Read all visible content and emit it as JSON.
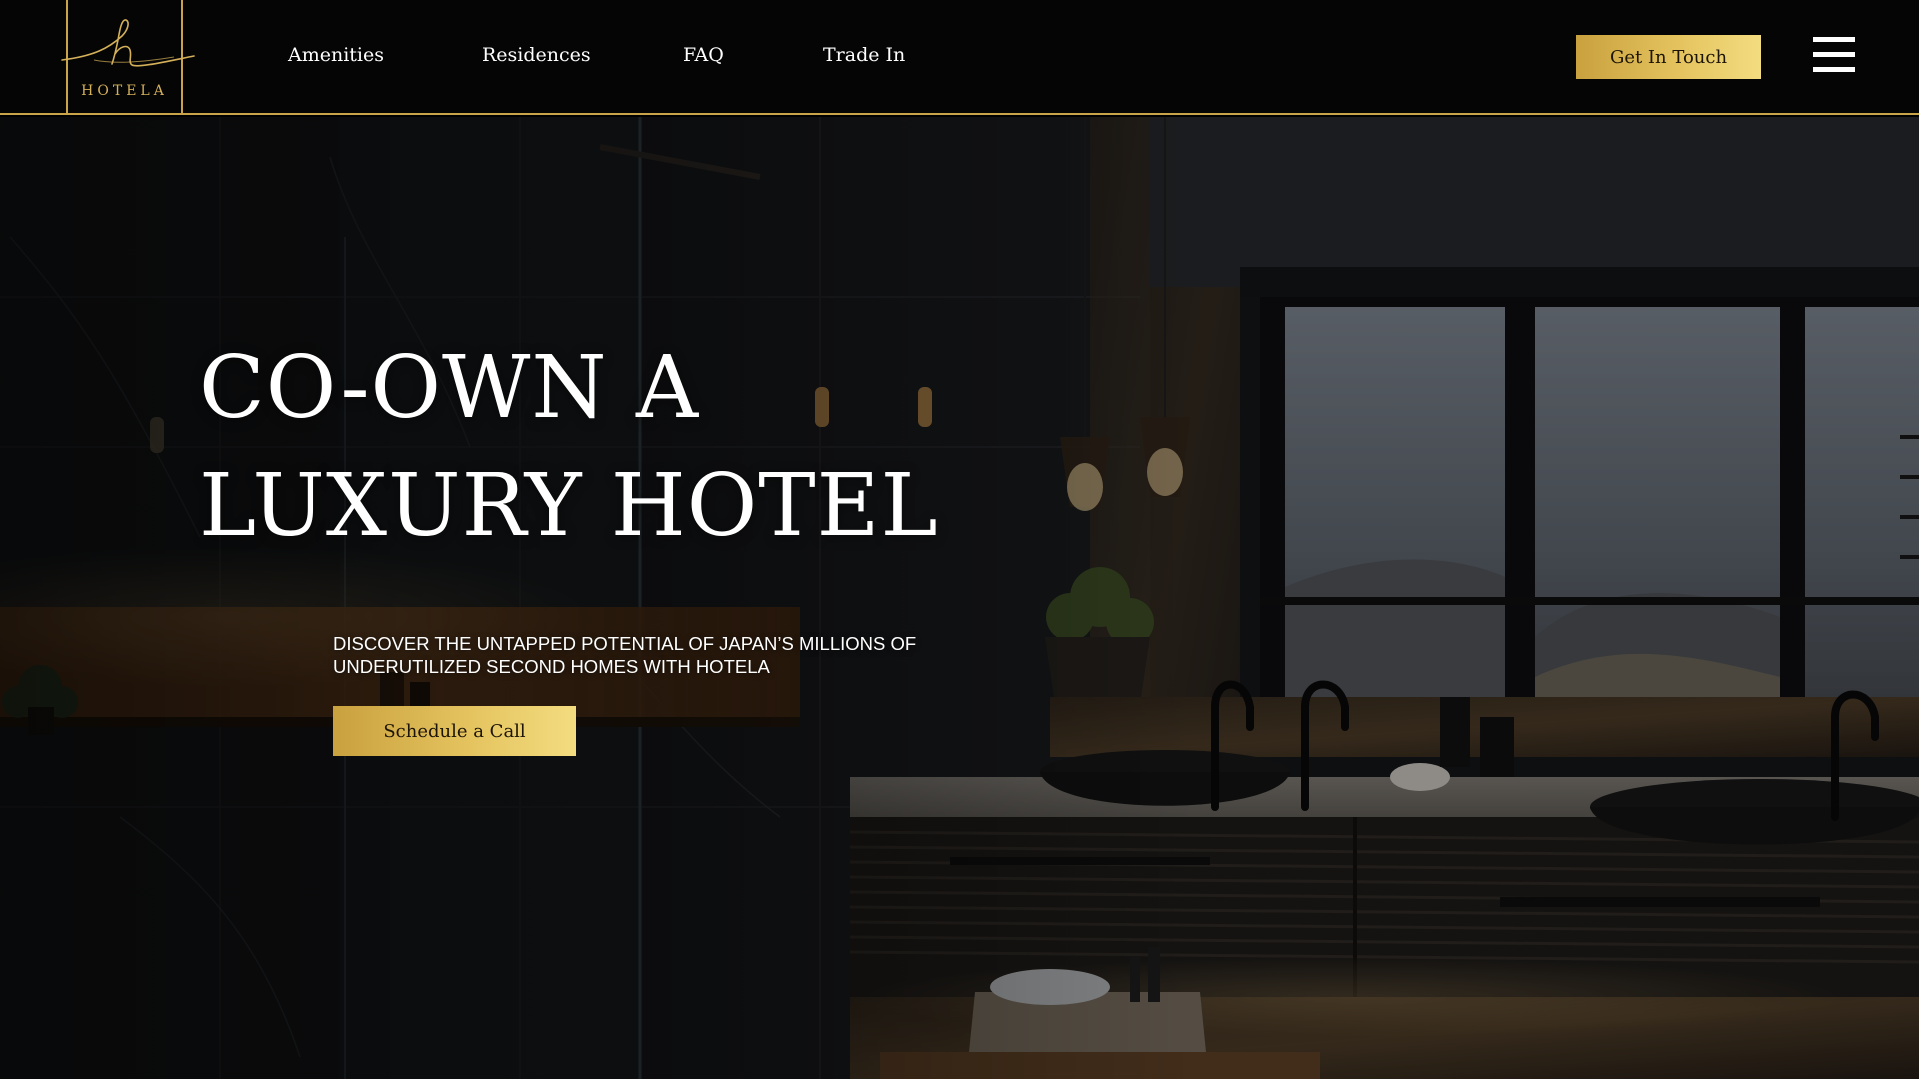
{
  "brand": {
    "name": "HOTELA",
    "mark": "h",
    "accent_color": "#c9a448"
  },
  "nav": {
    "links": [
      {
        "label": "Amenities"
      },
      {
        "label": "Residences"
      },
      {
        "label": "FAQ"
      },
      {
        "label": "Trade In"
      }
    ],
    "cta_label": "Get In Touch",
    "menu_icon": "hamburger-menu-icon"
  },
  "hero": {
    "title_line1": "CO-OWN A",
    "title_line2": "LUXURY HOTEL",
    "subtitle": "DISCOVER THE UNTAPPED POTENTIAL OF JAPAN’S MILLIONS OF UNDERUTILIZED SECOND HOMES WITH HOTELA",
    "cta_label": "Schedule a Call",
    "background": "luxury-bathroom-photo"
  }
}
